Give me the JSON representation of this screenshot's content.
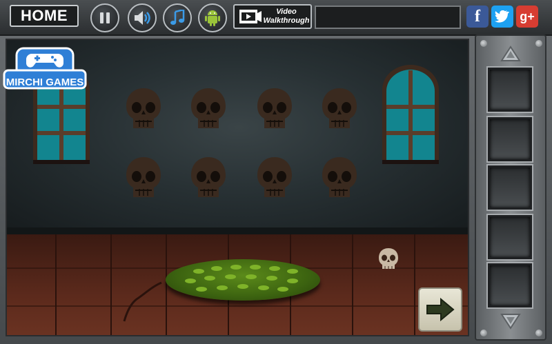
{
  "topbar": {
    "home_label": "HOME",
    "buttons": [
      {
        "name": "pause",
        "icon": "pause-icon"
      },
      {
        "name": "sound",
        "icon": "speaker-icon"
      },
      {
        "name": "music",
        "icon": "music-note-icon"
      },
      {
        "name": "android",
        "icon": "android-icon"
      }
    ],
    "video_label_line1": "Video",
    "video_label_line2": "Walkthrough",
    "social": [
      {
        "name": "facebook",
        "glyph": "f",
        "color": "#3b5998"
      },
      {
        "name": "twitter",
        "glyph": "t",
        "color": "#1da1f2"
      },
      {
        "name": "google-plus",
        "glyph": "g+",
        "color": "#d73d32"
      }
    ]
  },
  "logo": {
    "text": "MIRCHI GAMES",
    "icon": "gamepad-icon",
    "color": "#2f7fd6"
  },
  "scene": {
    "wall_skulls": 8,
    "floor_skull": "skull-icon",
    "rug": "green-spotted-rug",
    "next_arrow": "arrow-right-icon"
  },
  "inventory": {
    "slots": 5,
    "up_arrow": "arrow-up-icon",
    "down_arrow": "arrow-down-icon"
  }
}
